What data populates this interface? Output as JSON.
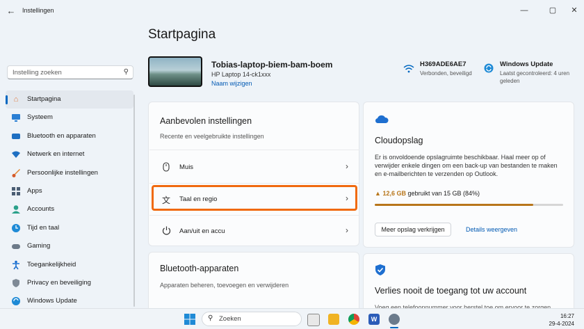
{
  "window": {
    "title": "Instellingen"
  },
  "search": {
    "placeholder": "Instelling zoeken"
  },
  "nav": [
    {
      "label": "Startpagina",
      "icon": "home-icon",
      "active": true
    },
    {
      "label": "Systeem",
      "icon": "monitor-icon"
    },
    {
      "label": "Bluetooth en apparaten",
      "icon": "bluetooth-icon"
    },
    {
      "label": "Netwerk en internet",
      "icon": "wifi-icon"
    },
    {
      "label": "Persoonlijke instellingen",
      "icon": "brush-icon"
    },
    {
      "label": "Apps",
      "icon": "apps-icon"
    },
    {
      "label": "Accounts",
      "icon": "person-icon"
    },
    {
      "label": "Tijd en taal",
      "icon": "globe-clock-icon"
    },
    {
      "label": "Gaming",
      "icon": "controller-icon"
    },
    {
      "label": "Toegankelijkheid",
      "icon": "accessibility-icon"
    },
    {
      "label": "Privacy en beveiliging",
      "icon": "shield-icon"
    },
    {
      "label": "Windows Update",
      "icon": "update-icon"
    }
  ],
  "page": {
    "title": "Startpagina"
  },
  "device": {
    "name": "Tobias-laptop-biem-bam-boem",
    "model": "HP Laptop 14-ck1xxx",
    "rename": "Naam wijzigen"
  },
  "network": {
    "name": "H369ADE6AE7",
    "status": "Verbonden, beveiligd"
  },
  "update": {
    "title": "Windows Update",
    "status": "Laatst gecontroleerd: 4 uren geleden"
  },
  "recommended": {
    "title": "Aanbevolen instellingen",
    "subtitle": "Recente en veelgebruikte instellingen",
    "items": [
      {
        "label": "Muis",
        "icon": "mouse-icon"
      },
      {
        "label": "Taal en regio",
        "icon": "language-icon"
      },
      {
        "label": "Aan/uit en accu",
        "icon": "power-icon"
      }
    ]
  },
  "bluetooth_card": {
    "title": "Bluetooth-apparaten",
    "subtitle": "Apparaten beheren, toevoegen en verwijderen"
  },
  "cloud": {
    "title": "Cloudopslag",
    "description": "Er is onvoldoende opslagruimte beschikbaar. Haal meer op of verwijder enkele dingen om een back-up van bestanden te maken en e-mailberichten te verzenden op Outlook.",
    "used": "12,6 GB",
    "used_text": "gebruikt van 15 GB (84%)",
    "used_fraction": 0.84,
    "button": "Meer opslag verkrijgen",
    "link": "Details weergeven",
    "bar_color": "#b8761a"
  },
  "account_card": {
    "title": "Verlies nooit de toegang tot uw account",
    "partial_text": "Voeg een telefoonnummer voor herstel toe om ervoor te zorgen"
  },
  "taskbar": {
    "search_placeholder": "Zoeken",
    "time": "16:27",
    "date": "29-4-2024"
  },
  "colors": {
    "accent": "#0067c0",
    "highlight": "#f06a0f"
  }
}
